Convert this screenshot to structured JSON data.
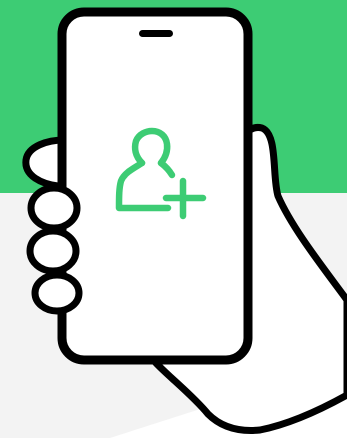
{
  "illustration": {
    "subject": "hand-holding-phone",
    "icon": "add-user-icon"
  },
  "colors": {
    "accent_green": "#3DCC74",
    "background_light": "#F3F3F3",
    "background_white": "#FFFFFF",
    "outline": "#000000"
  }
}
